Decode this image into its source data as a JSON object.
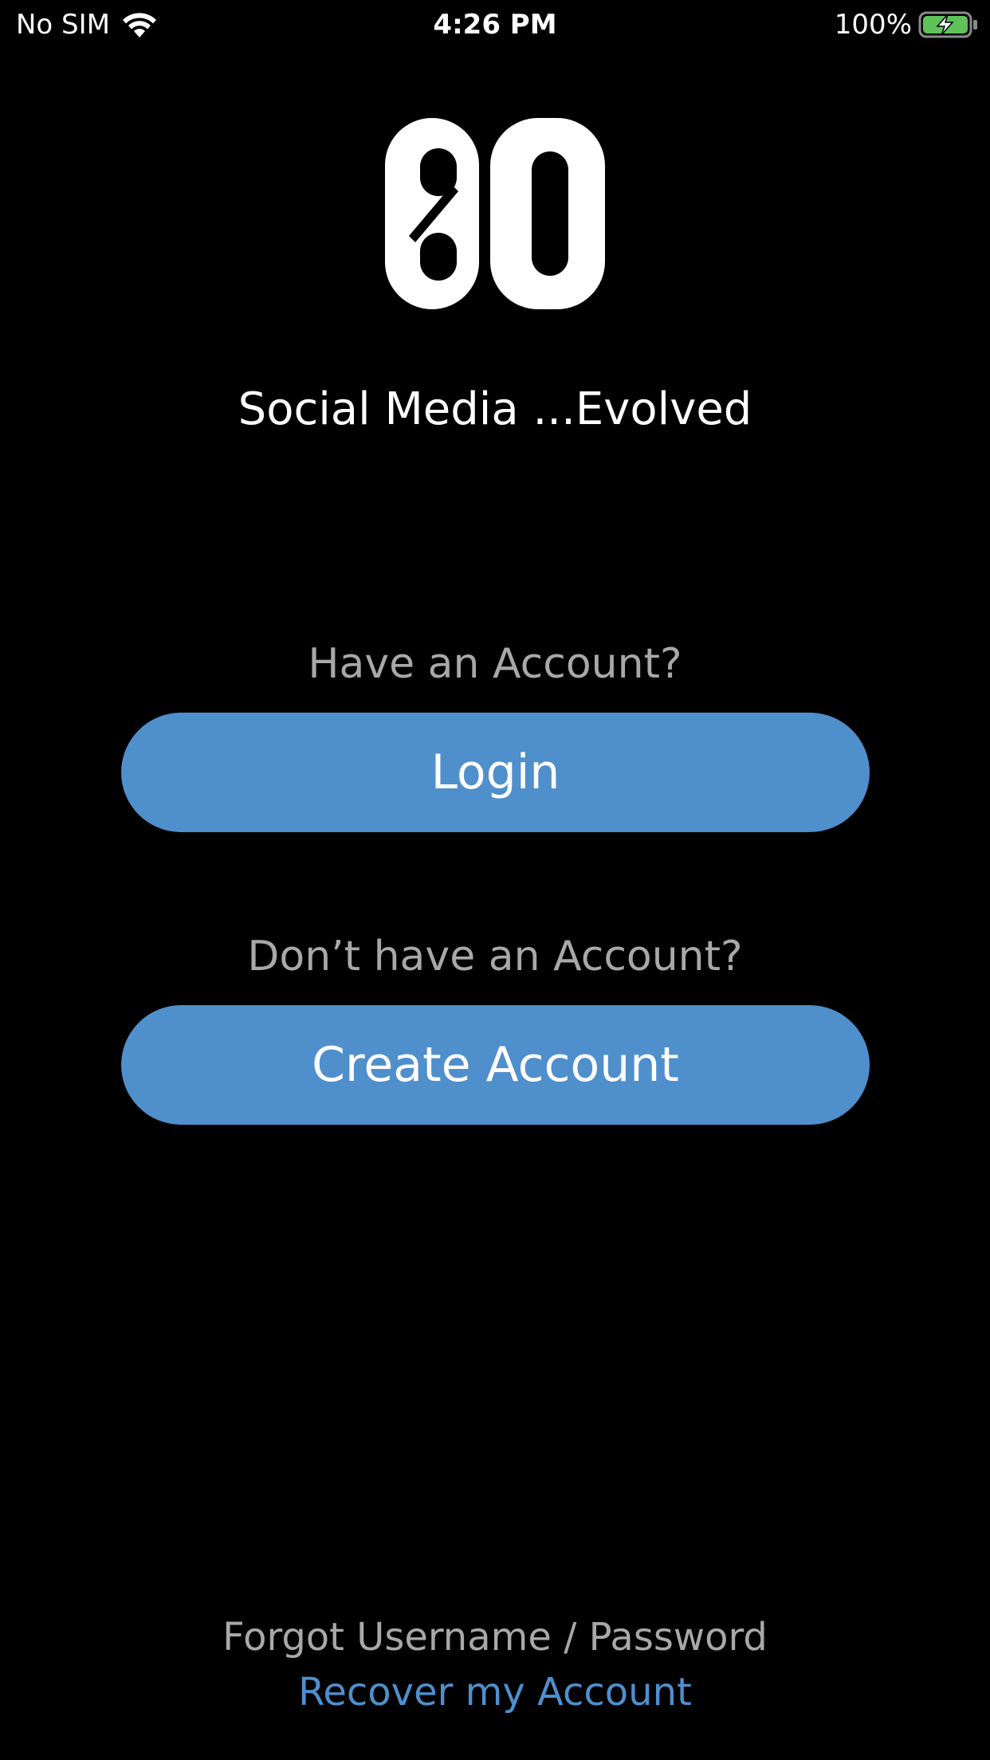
{
  "status_bar": {
    "carrier": "No SIM",
    "time": "4:26 PM",
    "battery_percent": "100%",
    "wifi_icon": "wifi-icon",
    "battery_icon": "battery-charging-icon"
  },
  "logo": {
    "text": "80",
    "icon": "app-logo"
  },
  "tagline": "Social Media ...Evolved",
  "login_section": {
    "prompt": "Have an Account?",
    "button_label": "Login"
  },
  "create_section": {
    "prompt": "Don’t have an Account?",
    "button_label": "Create Account"
  },
  "recovery": {
    "prompt": "Forgot Username / Password",
    "link_label": "Recover my Account"
  },
  "colors": {
    "background": "#000000",
    "accent": "#4f8fcc",
    "muted_text": "#a8a8a8",
    "battery_green": "#5fc35a"
  }
}
